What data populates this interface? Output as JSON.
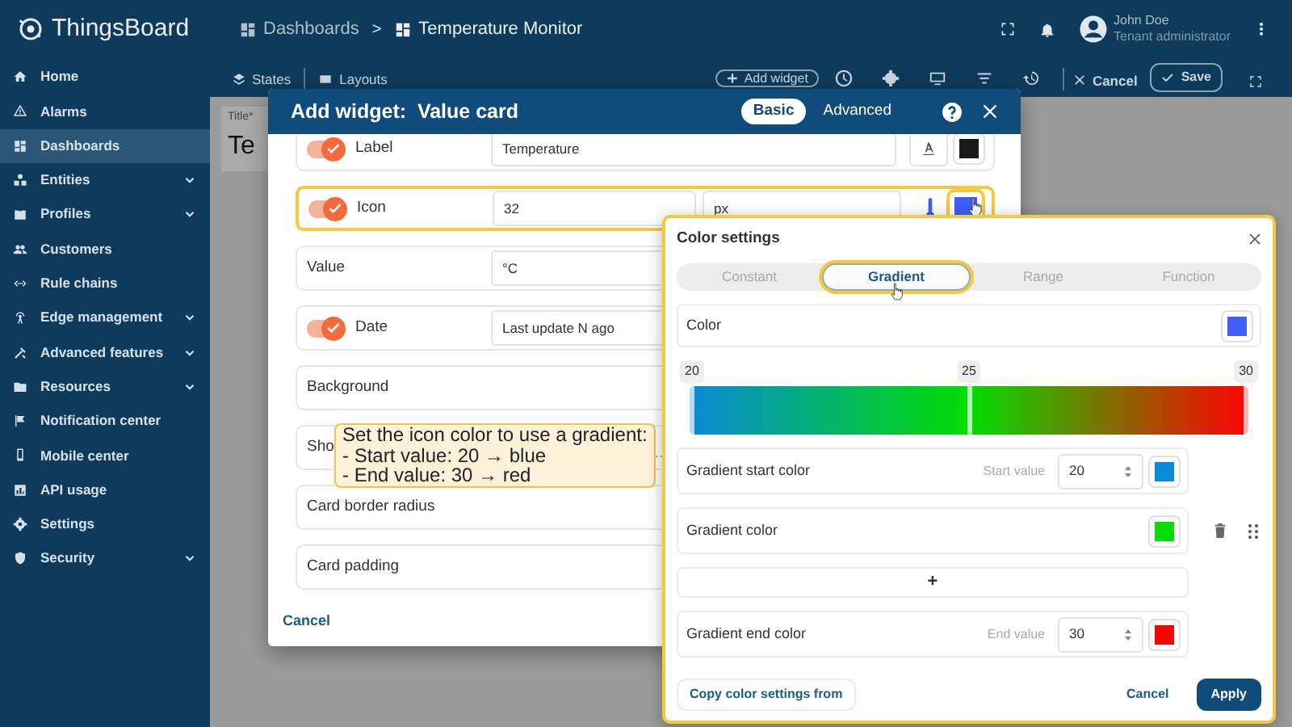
{
  "app": {
    "logo": "ThingsBoard"
  },
  "breadcrumb": [
    {
      "label": "Dashboards"
    },
    {
      "label": "Temperature Monitor"
    }
  ],
  "breadcrumb_separator": ">",
  "user": {
    "name": "John Doe",
    "role": "Tenant administrator"
  },
  "sidebar": {
    "items": [
      {
        "label": "Home",
        "expandable": false,
        "selected": false
      },
      {
        "label": "Alarms",
        "expandable": false,
        "selected": false
      },
      {
        "label": "Dashboards",
        "expandable": false,
        "selected": true
      },
      {
        "label": "Entities",
        "expandable": true,
        "selected": false
      },
      {
        "label": "Profiles",
        "expandable": true,
        "selected": false
      },
      {
        "label": "Customers",
        "expandable": false,
        "selected": false
      },
      {
        "label": "Rule chains",
        "expandable": false,
        "selected": false
      },
      {
        "label": "Edge management",
        "expandable": true,
        "selected": false
      },
      {
        "label": "Advanced features",
        "expandable": true,
        "selected": false
      },
      {
        "label": "Resources",
        "expandable": true,
        "selected": false
      },
      {
        "label": "Notification center",
        "expandable": false,
        "selected": false
      },
      {
        "label": "Mobile center",
        "expandable": false,
        "selected": false
      },
      {
        "label": "API usage",
        "expandable": false,
        "selected": false
      },
      {
        "label": "Settings",
        "expandable": false,
        "selected": false
      },
      {
        "label": "Security",
        "expandable": true,
        "selected": false
      }
    ]
  },
  "toolbar": {
    "states": "States",
    "layouts": "Layouts",
    "add_widget": "Add widget",
    "cancel": "Cancel",
    "save": "Save"
  },
  "dashboard": {
    "title_label": "Title*",
    "title": "Te"
  },
  "dialog": {
    "title": "Add widget:  Value card",
    "modes": [
      {
        "label": "Basic",
        "selected": true
      },
      {
        "label": "Advanced",
        "selected": false
      }
    ],
    "rows": [
      {
        "kind": "label",
        "toggle": true,
        "label": "Label",
        "value": "Temperature",
        "color": "#1a1a1a",
        "highlighted": false
      },
      {
        "kind": "icon",
        "toggle": true,
        "label": "Icon",
        "value": "32",
        "unit": "px",
        "color": "#3f5ef8",
        "highlighted": true
      },
      {
        "kind": "field",
        "label": "Value",
        "value": "°C",
        "highlighted": false
      },
      {
        "kind": "field",
        "toggle": true,
        "label": "Date",
        "value": "Last update N ago",
        "highlighted": false
      },
      {
        "kind": "plain",
        "label": "Background",
        "highlighted": false
      },
      {
        "kind": "plain",
        "label": "Sho",
        "highlighted": false
      },
      {
        "kind": "plain",
        "label": "Card border radius",
        "highlighted": false
      },
      {
        "kind": "plain",
        "label": "Card padding",
        "highlighted": false
      }
    ],
    "cancel": "Cancel"
  },
  "color_settings": {
    "title": "Color settings",
    "tabs": [
      {
        "label": "Constant",
        "selected": false,
        "highlighted": false
      },
      {
        "label": "Gradient",
        "selected": true,
        "highlighted": true
      },
      {
        "label": "Range",
        "selected": false,
        "highlighted": false
      },
      {
        "label": "Function",
        "selected": false,
        "highlighted": false
      }
    ],
    "color": {
      "label": "Color",
      "color": "#3f5ef8"
    },
    "gradient_labels": [
      "20",
      "25",
      "30"
    ],
    "stops": [
      {
        "kind": "start",
        "label": "Gradient start color",
        "value_label": "Start value",
        "value": "20",
        "color": "#0a8ad6"
      },
      {
        "kind": "middle",
        "label": "Gradient color",
        "color": "#00dd00"
      },
      {
        "kind": "end",
        "label": "Gradient end color",
        "value_label": "End value",
        "value": "30",
        "color": "#ff0000"
      }
    ],
    "add": "+",
    "copy": "Copy color settings from",
    "cancel": "Cancel",
    "apply": "Apply"
  },
  "tooltip": {
    "lines": [
      "Set the icon color to use a gradient:",
      "- Start value: 20 → blue",
      "- End value: 30 → red"
    ]
  }
}
